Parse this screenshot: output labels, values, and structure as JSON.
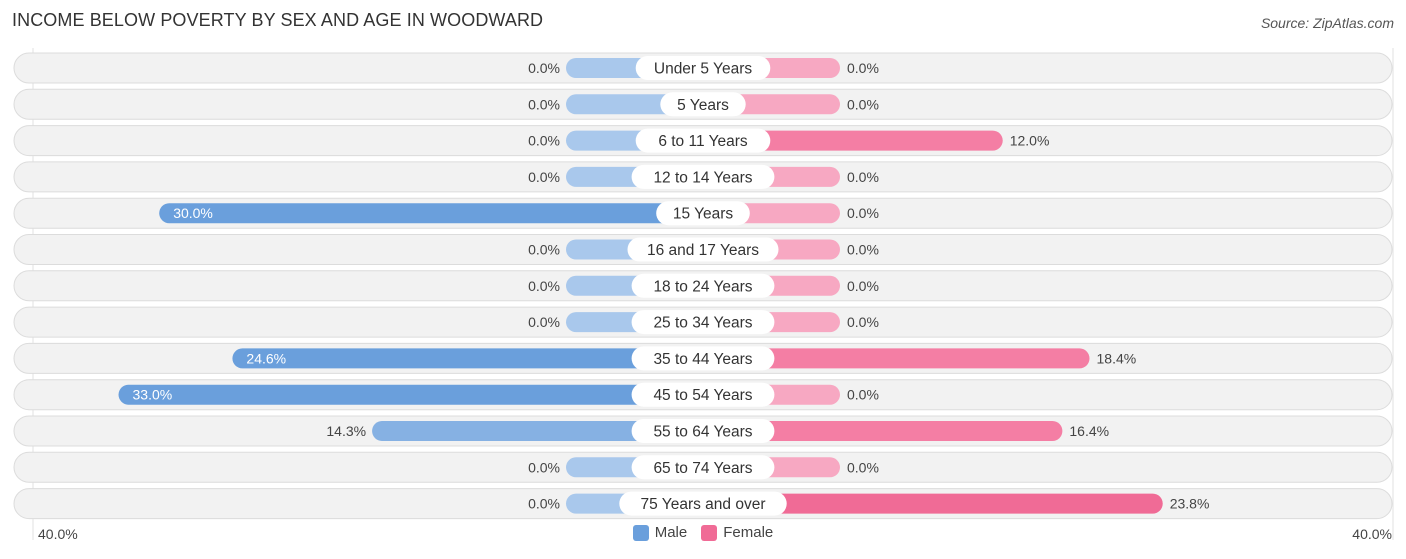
{
  "header": {
    "title": "INCOME BELOW POVERTY BY SEX AND AGE IN WOODWARD",
    "source": "Source: ZipAtlas.com"
  },
  "colors": {
    "male_strong": "#6a9fdc",
    "male_light": "#a9c8ec",
    "female_strong": "#f06b96",
    "female_light": "#f7a8c2",
    "row_bg": "#f2f2f2",
    "row_border": "#dcdcdc"
  },
  "chart_data": {
    "type": "bar",
    "orientation": "horizontal-diverging",
    "title": "INCOME BELOW POVERTY BY SEX AND AGE IN WOODWARD",
    "categories": [
      "Under 5 Years",
      "5 Years",
      "6 to 11 Years",
      "12 to 14 Years",
      "15 Years",
      "16 and 17 Years",
      "18 to 24 Years",
      "25 to 34 Years",
      "35 to 44 Years",
      "45 to 54 Years",
      "55 to 64 Years",
      "65 to 74 Years",
      "75 Years and over"
    ],
    "series": [
      {
        "name": "Male",
        "values": [
          0.0,
          0.0,
          0.0,
          0.0,
          30.0,
          0.0,
          0.0,
          0.0,
          24.6,
          33.0,
          14.3,
          0.0,
          0.0
        ]
      },
      {
        "name": "Female",
        "values": [
          0.0,
          0.0,
          12.0,
          0.0,
          0.0,
          0.0,
          0.0,
          0.0,
          18.4,
          0.0,
          16.4,
          0.0,
          23.8
        ]
      }
    ],
    "value_labels": {
      "male": [
        "0.0%",
        "0.0%",
        "0.0%",
        "0.0%",
        "30.0%",
        "0.0%",
        "0.0%",
        "0.0%",
        "24.6%",
        "33.0%",
        "14.3%",
        "0.0%",
        "0.0%"
      ],
      "female": [
        "0.0%",
        "0.0%",
        "12.0%",
        "0.0%",
        "0.0%",
        "0.0%",
        "0.0%",
        "0.0%",
        "18.4%",
        "0.0%",
        "16.4%",
        "0.0%",
        "23.8%"
      ]
    },
    "xlim": [
      -40,
      40
    ],
    "axis_tick_labels": {
      "left": "40.0%",
      "right": "40.0%"
    },
    "legend": {
      "position": "bottom-center",
      "entries": [
        "Male",
        "Female"
      ]
    },
    "unit": "%"
  }
}
